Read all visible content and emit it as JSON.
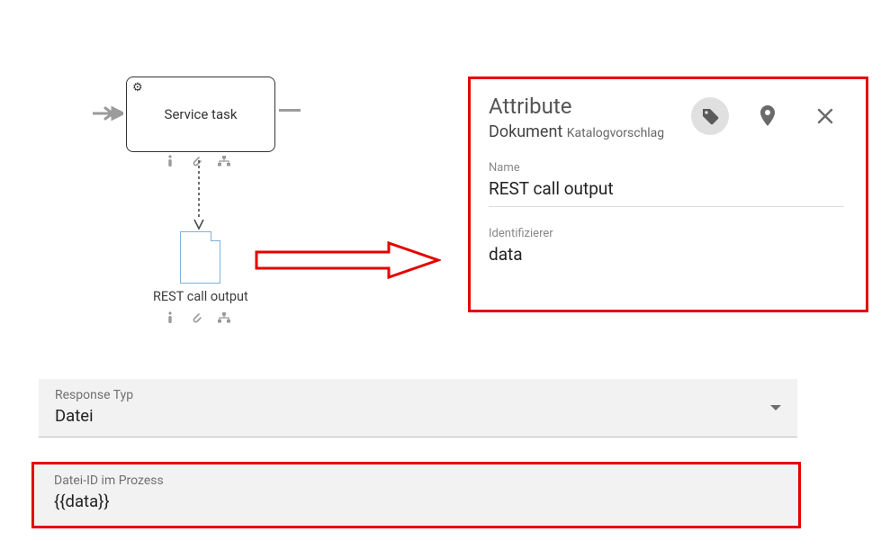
{
  "diagram": {
    "task_label": "Service task",
    "doc_label": "REST call output"
  },
  "panel": {
    "title": "Attribute",
    "doc_type": "Dokument",
    "catalog_hint": "Katalogvorschlag",
    "name_label": "Name",
    "name_value": "REST call output",
    "identifier_label": "Identifizierer",
    "identifier_value": "data",
    "icons": {
      "tag": "tag-icon",
      "location": "location-icon",
      "close": "close-icon"
    }
  },
  "form": {
    "response_type": {
      "label": "Response Typ",
      "value": "Datei"
    },
    "file_id": {
      "label": "Datei-ID im Prozess",
      "value": "{{data}}"
    }
  }
}
